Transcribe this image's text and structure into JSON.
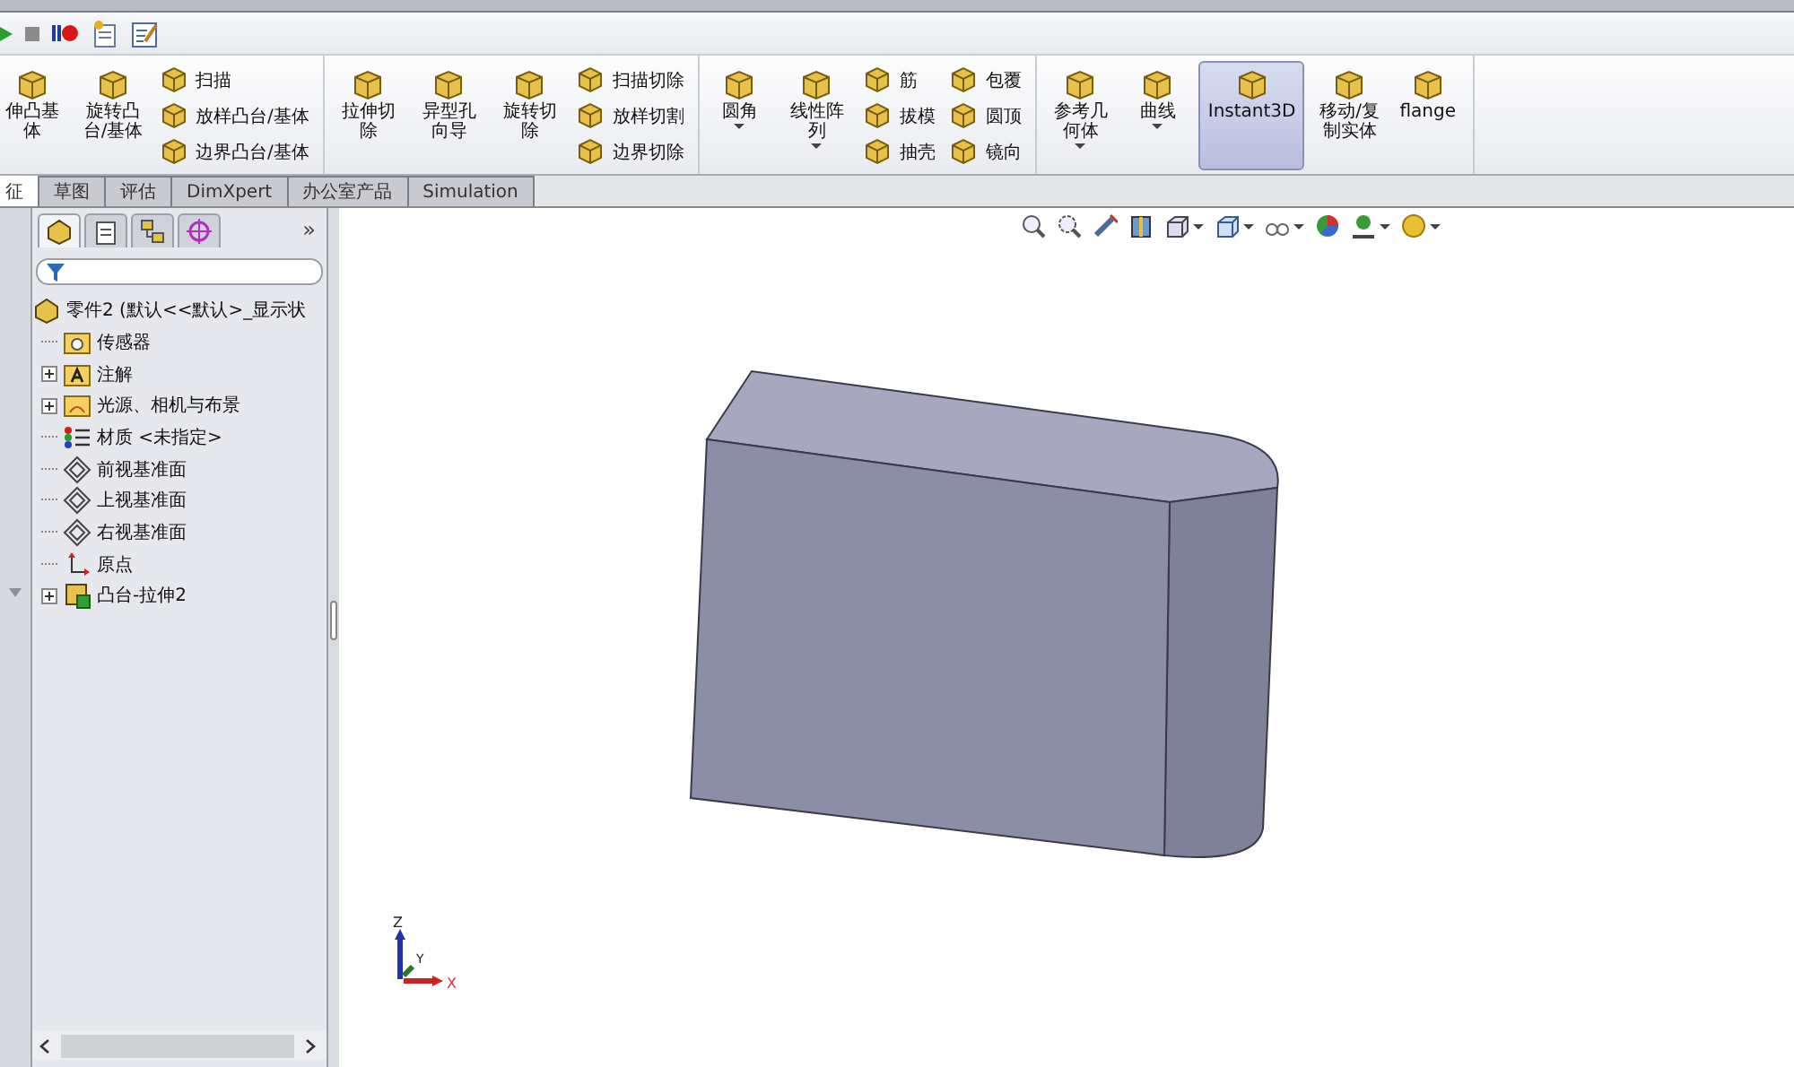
{
  "ribbon": {
    "groups": [
      {
        "large": [
          {
            "label": "伸凸基体",
            "dropdown": false,
            "selected": false
          },
          {
            "label": "旋转凸台/基体",
            "dropdown": false,
            "selected": false
          }
        ],
        "columns": [
          [
            "扫描",
            "放样凸台/基体",
            "边界凸台/基体"
          ]
        ]
      },
      {
        "large": [
          {
            "label": "拉伸切除",
            "dropdown": false,
            "selected": false
          },
          {
            "label": "异型孔向导",
            "dropdown": false,
            "selected": false
          },
          {
            "label": "旋转切除",
            "dropdown": false,
            "selected": false
          }
        ],
        "columns": [
          [
            "扫描切除",
            "放样切割",
            "边界切除"
          ]
        ]
      },
      {
        "large": [
          {
            "label": "圆角",
            "dropdown": true,
            "selected": false
          },
          {
            "label": "线性阵列",
            "dropdown": true,
            "selected": false
          }
        ],
        "columns": [
          [
            "筋",
            "拔模",
            "抽壳"
          ],
          [
            "包覆",
            "圆顶",
            "镜向"
          ]
        ]
      },
      {
        "large": [
          {
            "label": "参考几何体",
            "dropdown": true,
            "selected": false
          },
          {
            "label": "曲线",
            "dropdown": true,
            "selected": false
          },
          {
            "label": "Instant3D",
            "dropdown": false,
            "selected": true
          },
          {
            "label": "移动/复制实体",
            "dropdown": false,
            "selected": false
          },
          {
            "label": "flange",
            "dropdown": false,
            "selected": false
          }
        ]
      }
    ]
  },
  "tabs": [
    {
      "label": "征",
      "selected": true
    },
    {
      "label": "草图",
      "selected": false
    },
    {
      "label": "评估",
      "selected": false
    },
    {
      "label": "DimXpert",
      "selected": false
    },
    {
      "label": "办公室产品",
      "selected": false
    },
    {
      "label": "Simulation",
      "selected": false
    }
  ],
  "panel": {
    "more": "»",
    "tree": {
      "label": "零件2 (默认<<默认>_显示状",
      "children": [
        {
          "label": "传感器",
          "kind": "sensor",
          "expandable": false
        },
        {
          "label": "注解",
          "kind": "annotation",
          "expandable": true
        },
        {
          "label": "光源、相机与布景",
          "kind": "lights",
          "expandable": true
        },
        {
          "label": "材质 <未指定>",
          "kind": "material",
          "expandable": false
        },
        {
          "label": "前视基准面",
          "kind": "plane",
          "expandable": false
        },
        {
          "label": "上视基准面",
          "kind": "plane",
          "expandable": false
        },
        {
          "label": "右视基准面",
          "kind": "plane",
          "expandable": false
        },
        {
          "label": "原点",
          "kind": "origin",
          "expandable": false
        },
        {
          "label": "凸台-拉伸2",
          "kind": "feature",
          "expandable": true
        }
      ]
    }
  },
  "triad": {
    "z": "Z",
    "y": "Y",
    "x": "X"
  }
}
